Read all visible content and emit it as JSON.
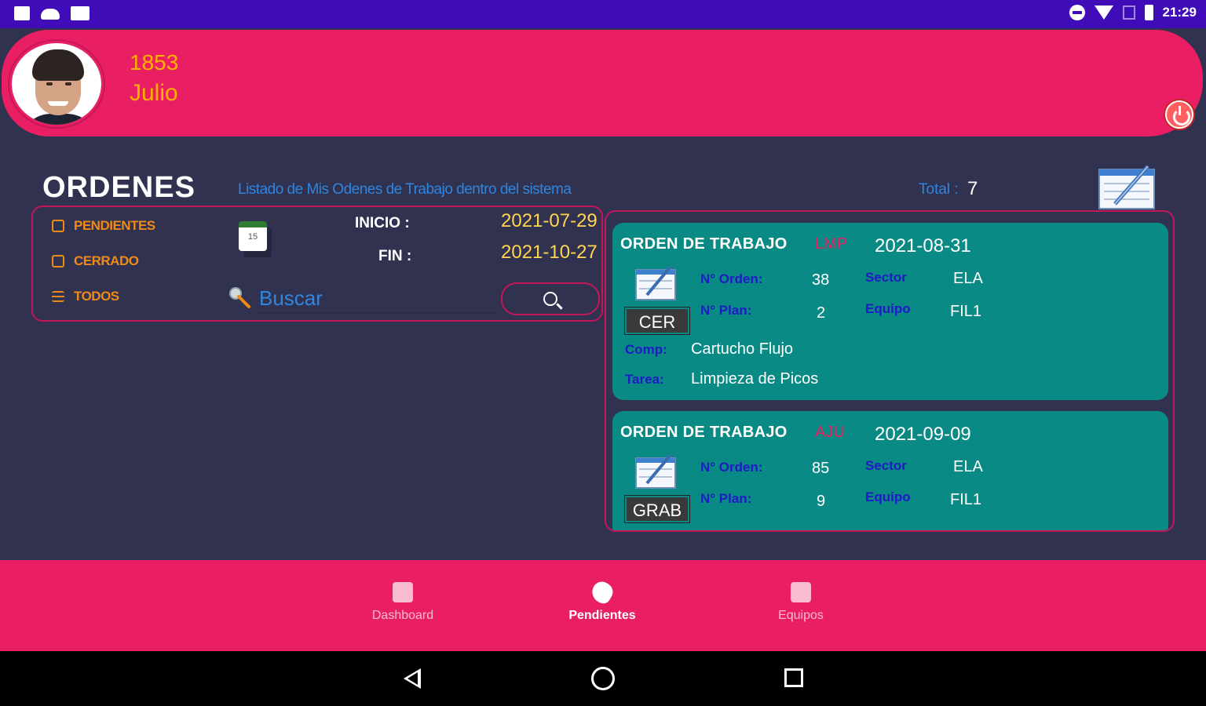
{
  "status_bar": {
    "time": "21:29"
  },
  "header": {
    "user_id": "1853",
    "user_name": "Julio"
  },
  "page": {
    "title": "ORDENES",
    "subtitle": "Listado de Mis Odenes de Trabajo dentro del sistema",
    "total_label": "Total :",
    "total_value": "7"
  },
  "filters": {
    "items": [
      {
        "label": "PENDIENTES",
        "icon": "pending-icon"
      },
      {
        "label": "CERRADO",
        "icon": "closed-icon"
      },
      {
        "label": "TODOS",
        "icon": "menu-icon"
      }
    ],
    "inicio_label": "INICIO :",
    "inicio_value": "2021-07-29",
    "fin_label": "FIN :",
    "fin_value": "2021-10-27",
    "calendar_day": "15",
    "search_placeholder": "Buscar"
  },
  "orders": [
    {
      "title": "ORDEN DE TRABAJO",
      "code": "LMP",
      "date": "2021-08-31",
      "status": "CER",
      "orden_label": "N° Orden:",
      "orden_value": "38",
      "plan_label": "N° Plan:",
      "plan_value": "2",
      "sector_label": "Sector",
      "sector_value": "ELA",
      "equipo_label": "Equipo",
      "equipo_value": "FIL1",
      "comp_label": "Comp:",
      "comp_value": "Cartucho Flujo",
      "tarea_label": "Tarea:",
      "tarea_value": "Limpieza de Picos"
    },
    {
      "title": "ORDEN DE TRABAJO",
      "code": "AJU",
      "date": "2021-09-09",
      "status": "GRAB",
      "orden_label": "N° Orden:",
      "orden_value": "85",
      "plan_label": "N° Plan:",
      "plan_value": "9",
      "sector_label": "Sector",
      "sector_value": "ELA",
      "equipo_label": "Equipo",
      "equipo_value": "FIL1"
    }
  ],
  "bottom_nav": [
    {
      "label": "Dashboard",
      "active": false
    },
    {
      "label": "Pendientes",
      "active": true
    },
    {
      "label": "Equipos",
      "active": false
    }
  ]
}
